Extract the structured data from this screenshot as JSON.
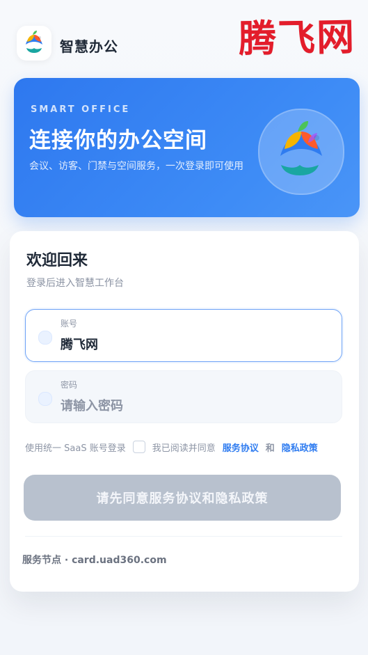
{
  "header": {
    "app_name": "智慧办公",
    "watermark": "腾飞网"
  },
  "hero": {
    "kicker": "SMART OFFICE",
    "title": "连接你的办公空间",
    "subtitle": "会议、访客、门禁与空间服务，一次登录即可使用"
  },
  "login": {
    "welcome": "欢迎回来",
    "welcome_sub": "登录后进入智慧工作台",
    "account": {
      "label": "账号",
      "value": "腾飞网"
    },
    "password": {
      "label": "密码",
      "placeholder": "请输入密码"
    },
    "agree": {
      "prefix": "使用统一 SaaS 账号登录",
      "checkbox_text": "我已阅读并同意",
      "service_link": "服务协议",
      "and": "和",
      "privacy_link": "隐私政策"
    },
    "primary_button": "请先同意服务协议和隐私政策",
    "service_node": "服务节点 · card.uad360.com"
  },
  "colors": {
    "primary_blue": "#2f7cf0",
    "watermark_red": "#e31d2b",
    "disabled_button": "#b8c1ce"
  },
  "icons": {
    "app": "peacock-logo-icon",
    "hero_badge": "peacock-logo-icon",
    "account_field": "dot-icon",
    "password_field": "dot-icon"
  }
}
